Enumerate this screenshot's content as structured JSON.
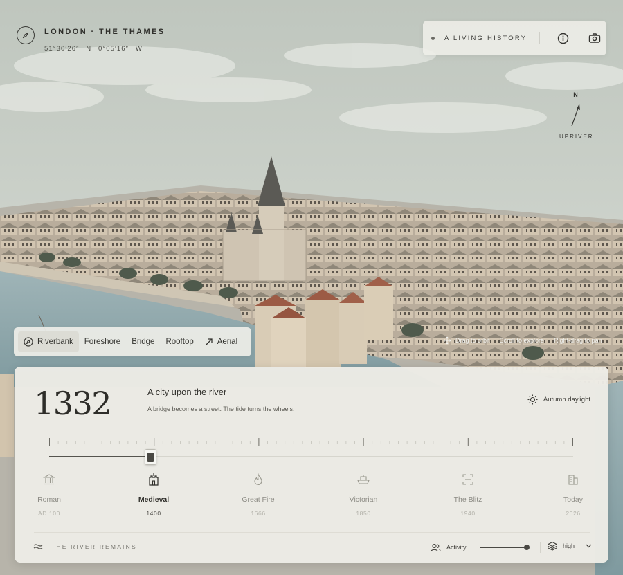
{
  "header": {
    "title": "LONDON · THE THAMES",
    "coords": "51°30′26″ N   0°05′16″ W",
    "icon": "compass-icon"
  },
  "topbar": {
    "status_label": "A LIVING HISTORY",
    "info_icon": "info-icon",
    "camera_icon": "camera-icon"
  },
  "orientation": {
    "north": "N",
    "label": "UPRIVER"
  },
  "views": [
    {
      "label": "Riverbank",
      "icon": "compass-icon",
      "active": true
    },
    {
      "label": "Foreshore",
      "active": false
    },
    {
      "label": "Bridge",
      "active": false
    },
    {
      "label": "Rooftop",
      "active": false
    },
    {
      "label": "Aerial",
      "icon": "arrow-up-right-icon",
      "active": false
    }
  ],
  "hints": [
    {
      "label": "Drag to orbit",
      "icon": "move-icon"
    },
    {
      "label": "Scroll to explore"
    },
    {
      "label": "Right-drag to pan"
    }
  ],
  "panel": {
    "year": "1332",
    "title": "A city upon the river",
    "subtitle": "A bridge becomes a street. The tide turns the wheels.",
    "lighting": "Autumn daylight",
    "timeline_progress": 0.196,
    "eras": [
      {
        "name": "Roman",
        "year": "AD 100",
        "icon": "temple-icon",
        "active": false
      },
      {
        "name": "Medieval",
        "year": "1400",
        "icon": "castle-icon",
        "active": true
      },
      {
        "name": "Great Fire",
        "year": "1666",
        "icon": "flame-icon",
        "active": false
      },
      {
        "name": "Victorian",
        "year": "1850",
        "icon": "steamship-icon",
        "active": false
      },
      {
        "name": "The Blitz",
        "year": "1940",
        "icon": "scan-icon",
        "active": false
      },
      {
        "name": "Today",
        "year": "2026",
        "icon": "buildings-icon",
        "active": false
      }
    ],
    "footer": {
      "river_label": "THE RIVER REMAINS",
      "activity_label": "Activity",
      "activity_level": 1.0,
      "quality": "high"
    }
  }
}
